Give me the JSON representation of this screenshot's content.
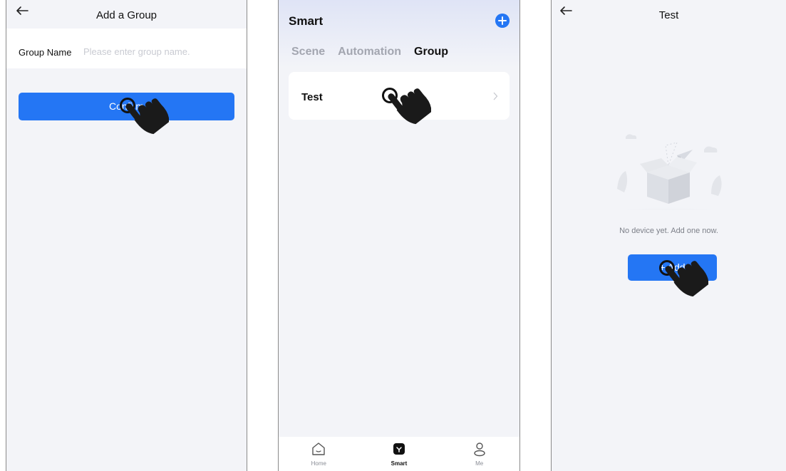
{
  "screen1": {
    "title": "Add a Group",
    "back_icon": "arrow-left-icon",
    "group_name_label": "Group Name",
    "group_name_placeholder": "Please enter group name.",
    "group_name_value": "",
    "confirm_label": "Confirm"
  },
  "screen2": {
    "title": "Smart",
    "add_icon": "plus-circle-icon",
    "tabs": [
      {
        "label": "Scene",
        "active": false
      },
      {
        "label": "Automation",
        "active": false
      },
      {
        "label": "Group",
        "active": true
      }
    ],
    "groups": [
      {
        "name": "Test"
      }
    ],
    "tabbar": [
      {
        "label": "Home",
        "icon": "home-icon",
        "active": false
      },
      {
        "label": "Smart",
        "icon": "smart-icon",
        "active": true
      },
      {
        "label": "Me",
        "icon": "person-icon",
        "active": false
      }
    ]
  },
  "screen3": {
    "title": "Test",
    "back_icon": "arrow-left-icon",
    "empty_illustration": "empty-box-icon",
    "empty_text": "No device yet. Add one now.",
    "add_label": "+ Add"
  },
  "overlay": {
    "pointer_icon": "hand-pointer-icon"
  },
  "colors": {
    "accent": "#2476f4",
    "background": "#f3f4f8",
    "card": "#ffffff",
    "muted_text": "#7d8089",
    "placeholder_text": "#c9cbd2"
  }
}
